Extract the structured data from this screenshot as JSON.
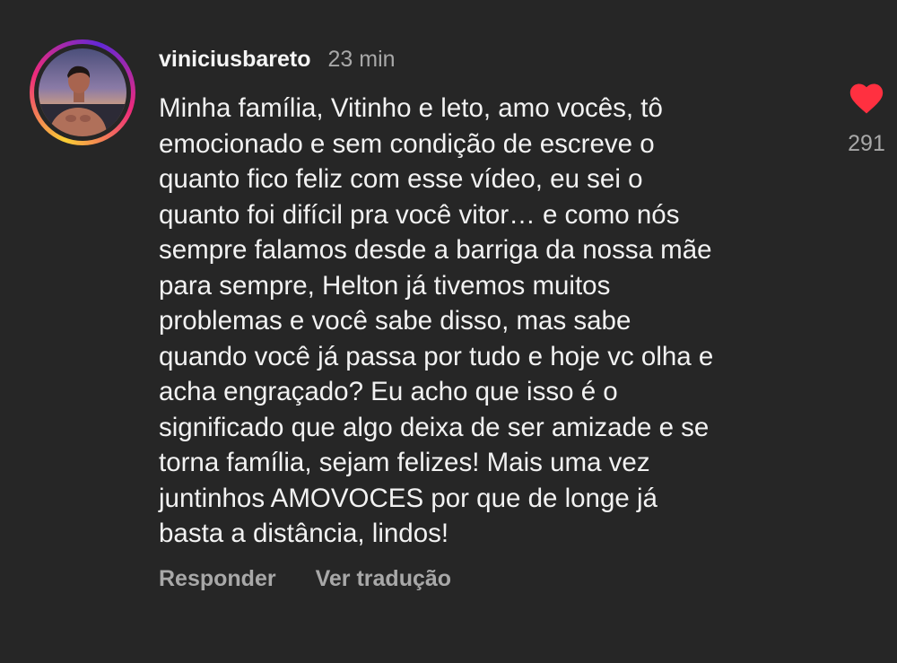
{
  "comment": {
    "username": "viniciusbareto",
    "time": "23 min",
    "lines": [
      "Minha família, Vitinho e leto, amo vocês, tô",
      "emocionado e sem condição de escreve o",
      "quanto fico feliz com esse vídeo, eu sei o",
      "quanto foi difícil pra você vitor… e como nós",
      "sempre falamos desde a barriga da nossa mãe",
      "para sempre, Helton já tivemos muitos",
      "problemas e você sabe disso, mas sabe",
      "quando você já passa por tudo e hoje vc olha e",
      "acha engraçado? Eu acho que isso é o",
      "significado que algo deixa de ser amizade e se",
      "torna família, sejam felizes! Mais uma vez",
      "juntinhos AMOVOCES por que de longe já",
      "basta a distância, lindos!"
    ],
    "reply_label": "Responder",
    "translate_label": "Ver tradução",
    "like_count": "291",
    "liked": true,
    "heart_color": "#ff3040",
    "avatar_icon": "profile-photo",
    "like_icon": "heart-icon"
  },
  "colors": {
    "background": "#262626",
    "text": "#f2f2f2",
    "secondary": "#a8a8a8"
  }
}
